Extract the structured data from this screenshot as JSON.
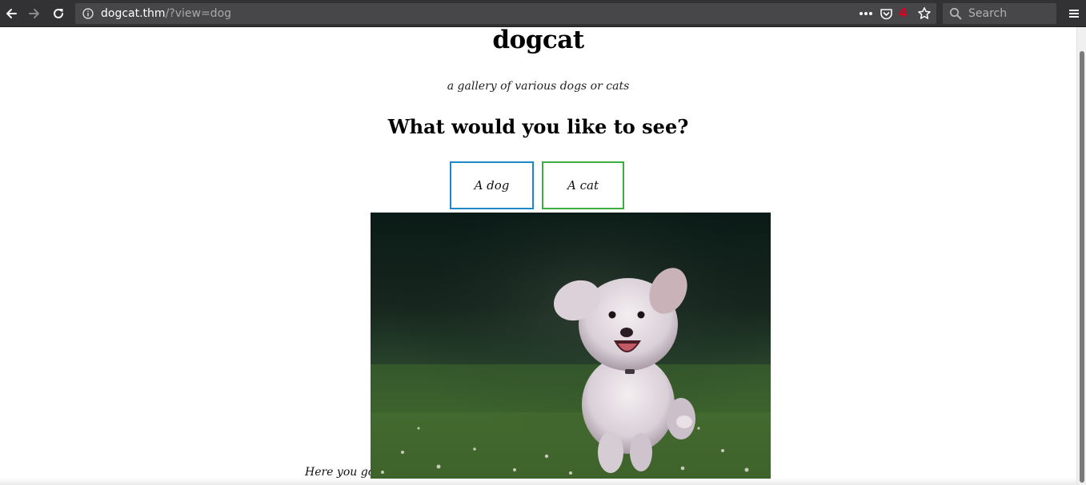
{
  "browser": {
    "url_host": "dogcat.thm",
    "url_path": "/?view=dog",
    "pocket_count": "4",
    "search_placeholder": "Search",
    "icons": {
      "back": "back-arrow-icon",
      "forward": "forward-arrow-icon",
      "reload": "reload-icon",
      "info": "info-icon",
      "more": "more-dots-icon",
      "pocket": "pocket-icon",
      "bookmark": "star-icon",
      "search": "search-icon",
      "menu": "hamburger-menu-icon"
    },
    "colors": {
      "toolbar": "#323234",
      "urlbar": "#474749",
      "badge": "#d70022"
    }
  },
  "page": {
    "title": "dogcat",
    "tagline": "a gallery of various dogs or cats",
    "question": "What would you like to see?",
    "buttons": {
      "dog": "A dog",
      "cat": "A cat"
    },
    "caption": "Here you go!",
    "image": "running-white-puppy-on-grass",
    "colors": {
      "dog_button_border": "#1e88c7",
      "cat_button_border": "#3cae3f"
    }
  }
}
